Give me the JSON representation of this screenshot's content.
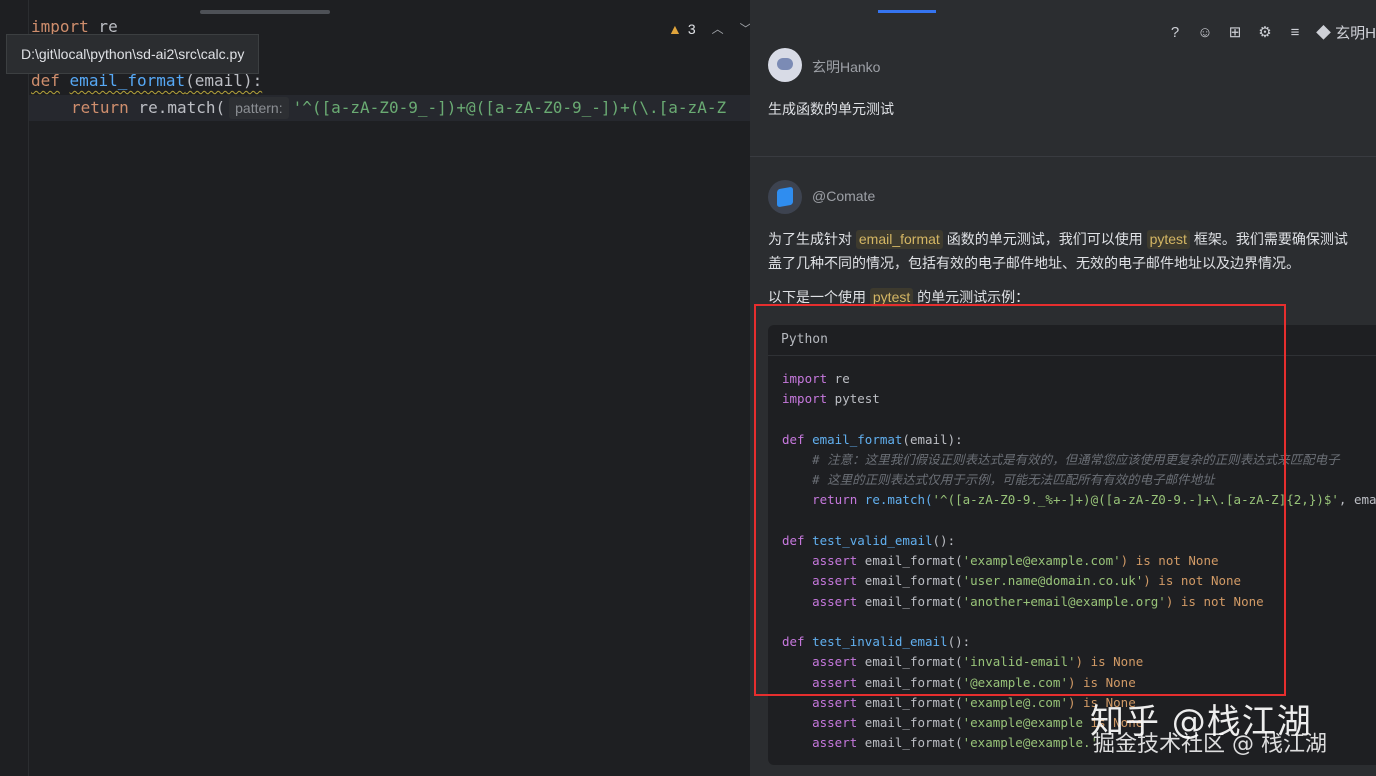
{
  "editor": {
    "tooltip_path": "D:\\git\\local\\python\\sd-ai2\\src\\calc.py",
    "warnings_count": "3",
    "line1": {
      "kw": "import",
      "rest": " re"
    },
    "line3": {
      "kw": "def",
      "fn": "email_format",
      "rest": "(email):"
    },
    "line4": {
      "kw": "return",
      "mid": " re.match(",
      "hint": "pattern:",
      "str": "'^([a-zA-Z0-9_-])+@([a-zA-Z0-9_-])+(\\.[a-zA-Z"
    }
  },
  "chat": {
    "toolbar": {
      "user": "玄明H"
    },
    "user": {
      "name": "玄明Hanko",
      "message": "生成函数的单元测试"
    },
    "bot": {
      "name": "@Comate",
      "p1_a": "为了生成针对 ",
      "p1_tag1": "email_format",
      "p1_b": " 函数的单元测试，我们可以使用 ",
      "p1_tag2": "pytest",
      "p1_c": " 框架。我们需要确保测试",
      "p2": "盖了几种不同的情况，包括有效的电子邮件地址、无效的电子邮件地址以及边界情况。",
      "p3_a": "以下是一个使用 ",
      "p3_tag": "pytest",
      "p3_b": " 的单元测试示例："
    },
    "code_block": {
      "language": "Python",
      "lines": {
        "l1": {
          "k": "import",
          "r": " re"
        },
        "l2": {
          "k": "import",
          "r": " pytest"
        },
        "l4": {
          "k": "def",
          "f": "email_format",
          "r": "(email):"
        },
        "l5": "    # 注意：这里我们假设正则表达式是有效的，但通常您应该使用更复杂的正则表达式来匹配电子",
        "l6": "    # 这里的正则表达式仅用于示例，可能无法匹配所有有效的电子邮件地址",
        "l7": {
          "k": "    return",
          "r": " re.match(",
          "s": "'^([a-zA-Z0-9._%+-]+)@([a-zA-Z0-9.-]+\\.[a-zA-Z]{2,})$'",
          "t": ", emai"
        },
        "l9": {
          "k": "def",
          "f": "test_valid_email",
          "r": "():"
        },
        "l10": {
          "k": "    assert",
          "r": " email_format(",
          "s": "'example@example.com'",
          "t": ") is not None"
        },
        "l11": {
          "k": "    assert",
          "r": " email_format(",
          "s": "'user.name@domain.co.uk'",
          "t": ") is not None"
        },
        "l12": {
          "k": "    assert",
          "r": " email_format(",
          "s": "'another+email@example.org'",
          "t": ") is not None"
        },
        "l14": {
          "k": "def",
          "f": "test_invalid_email",
          "r": "():"
        },
        "l15": {
          "k": "    assert",
          "r": " email_format(",
          "s": "'invalid-email'",
          "t": ") is None"
        },
        "l16": {
          "k": "    assert",
          "r": " email_format(",
          "s": "'@example.com'",
          "t": ") is None"
        },
        "l17": {
          "k": "    assert",
          "r": " email_format(",
          "s": "'example@.com'",
          "t": ") is None"
        },
        "l18": {
          "k": "    assert",
          "r": " email_format(",
          "s": "'example@example",
          "t": " is None"
        },
        "l19": {
          "k": "    assert",
          "r": " email_format(",
          "s": "'example@example.'",
          "t": ""
        }
      }
    }
  },
  "watermark": {
    "line1": "知乎 @栈江湖",
    "line2": "掘金技术社区 @ 栈江湖"
  },
  "colors": {
    "accent": "#3574f0",
    "highlight_box": "#e62e2e"
  }
}
